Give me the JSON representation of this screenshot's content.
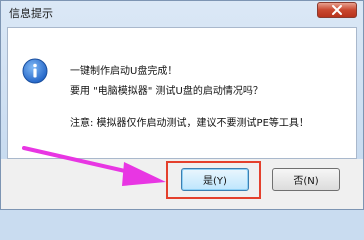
{
  "window": {
    "title": "信息提示"
  },
  "message": {
    "line1": "一键制作启动U盘完成！",
    "line2": "要用 \"电脑模拟器\" 测试U盘的启动情况吗？",
    "line3": "注意: 模拟器仅作启动测试，建议不要测试PE等工具！"
  },
  "buttons": {
    "yes": "是(Y)",
    "no": "否(N)"
  },
  "icons": {
    "close": "close-icon",
    "info": "info-icon",
    "arrow": "arrow-annotation"
  },
  "colors": {
    "annotation_arrow": "#e836e3",
    "highlight_box": "#e4402c",
    "close_button": "#c9472f"
  }
}
